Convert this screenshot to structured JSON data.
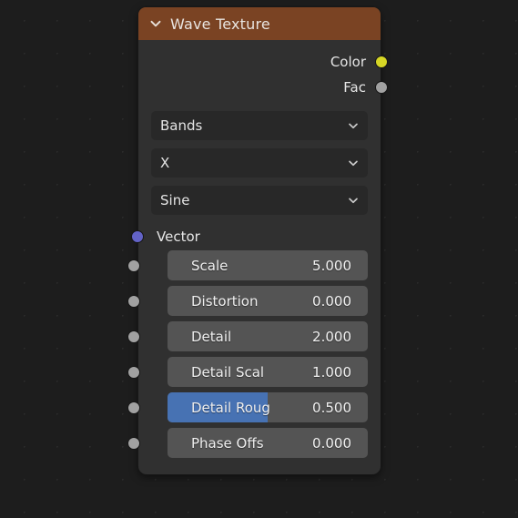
{
  "node": {
    "title": "Wave Texture",
    "header_color": "#7a4323",
    "body_color": "#303030",
    "collapse_icon": "chevron-down-icon",
    "outputs": [
      {
        "label": "Color",
        "socket_color": "#d6d625",
        "socket_type": "color"
      },
      {
        "label": "Fac",
        "socket_color": "#a1a1a1",
        "socket_type": "value"
      }
    ],
    "dropdowns": [
      {
        "name": "wave-type",
        "value": "Bands",
        "icon": "chevron-down-icon"
      },
      {
        "name": "bands-direction",
        "value": "X",
        "icon": "chevron-down-icon"
      },
      {
        "name": "wave-profile",
        "value": "Sine",
        "icon": "chevron-down-icon"
      }
    ],
    "vector_input": {
      "label": "Vector",
      "socket_color": "#6363c7",
      "socket_type": "vector"
    },
    "value_inputs": [
      {
        "label": "Scale",
        "value": "5.000",
        "fill_percent": 0,
        "socket_color": "#a1a1a1",
        "active": false
      },
      {
        "label": "Distortion",
        "value": "0.000",
        "fill_percent": 0,
        "socket_color": "#a1a1a1",
        "active": false
      },
      {
        "label": "Detail",
        "value": "2.000",
        "fill_percent": 0,
        "socket_color": "#a1a1a1",
        "active": false
      },
      {
        "label": "Detail Scal",
        "value": "1.000",
        "fill_percent": 0,
        "socket_color": "#a1a1a1",
        "active": false
      },
      {
        "label": "Detail Roug",
        "value": "0.500",
        "fill_percent": 50,
        "socket_color": "#a1a1a1",
        "active": true
      },
      {
        "label": "Phase Offs",
        "value": "0.000",
        "fill_percent": 0,
        "socket_color": "#a1a1a1",
        "active": false
      }
    ]
  },
  "canvas": {
    "background_color": "#1d1d1d",
    "grid_dot_color": "#2b2b2b"
  }
}
